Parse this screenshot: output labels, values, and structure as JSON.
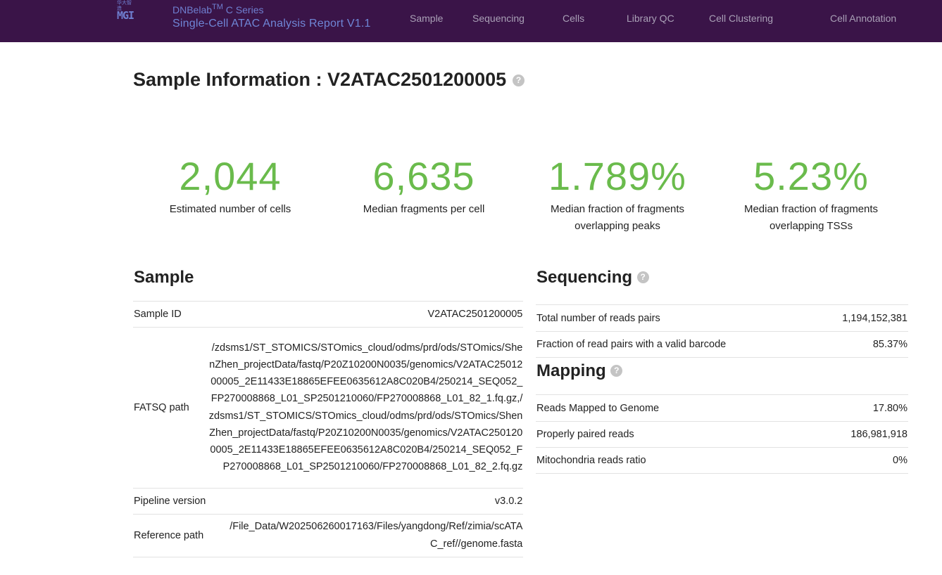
{
  "header": {
    "logo": {
      "top_text": "华大智造",
      "text": "MGI"
    },
    "brand_prefix": "DNBelab",
    "brand_tm": "TM",
    "brand_suffix": " C Series",
    "report_title": "Single-Cell ATAC Analysis Report V1.1",
    "colors": {
      "bar": "#3a1448",
      "brand": "#6f86d6",
      "nav": "#a9a0b6"
    }
  },
  "nav": {
    "sample": "Sample",
    "sequencing": "Sequencing",
    "cells": "Cells",
    "library_qc": "Library QC",
    "cell_clustering": "Cell Clustering",
    "cell_annotation": "Cell Annotation"
  },
  "page": {
    "title": "Sample Information : V2ATAC2501200005",
    "help_icon": "?"
  },
  "metrics": [
    {
      "value": "2,044",
      "label": "Estimated number of cells"
    },
    {
      "value": "6,635",
      "label": "Median fragments per cell"
    },
    {
      "value": "1.789%",
      "label": "Median fraction of fragments overlapping peaks"
    },
    {
      "value": "5.23%",
      "label": "Median fraction of fragments overlapping TSSs"
    }
  ],
  "metric_color": "#6abb4c",
  "sample_section": {
    "title": "Sample",
    "rows": [
      {
        "key": "Sample ID",
        "value": "V2ATAC2501200005"
      },
      {
        "key": "FATSQ path",
        "value": "/zdsms1/ST_STOMICS/STOmics_cloud/odms/prd/ods/STOmics/ShenZhen_projectData/fastq/P20Z10200N0035/genomics/V2ATAC2501200005_2E11433E18865EFEE0635612A8C020B4/250214_SEQ052_FP270008868_L01_SP2501210060/FP270008868_L01_82_1.fq.gz,/zdsms1/ST_STOMICS/STOmics_cloud/odms/prd/ods/STOmics/ShenZhen_projectData/fastq/P20Z10200N0035/genomics/V2ATAC2501200005_2E11433E18865EFEE0635612A8C020B4/250214_SEQ052_FP270008868_L01_SP2501210060/FP270008868_L01_82_2.fq.gz"
      },
      {
        "key": "Pipeline version",
        "value": "v3.0.2"
      },
      {
        "key": "Reference path",
        "value": "/File_Data/W202506260017163/Files/yangdong/Ref/zimia/scATAC_ref//genome.fasta"
      }
    ]
  },
  "sequencing_section": {
    "title": "Sequencing",
    "rows": [
      {
        "key": "Total number of reads pairs",
        "value": "1,194,152,381"
      },
      {
        "key": "Fraction of read pairs with a valid barcode",
        "value": "85.37%"
      }
    ]
  },
  "mapping_section": {
    "title": "Mapping",
    "rows": [
      {
        "key": "Reads Mapped to Genome",
        "value": "17.80%"
      },
      {
        "key": "Properly paired reads",
        "value": "186,981,918"
      },
      {
        "key": "Mitochondria reads ratio",
        "value": "0%"
      }
    ]
  }
}
